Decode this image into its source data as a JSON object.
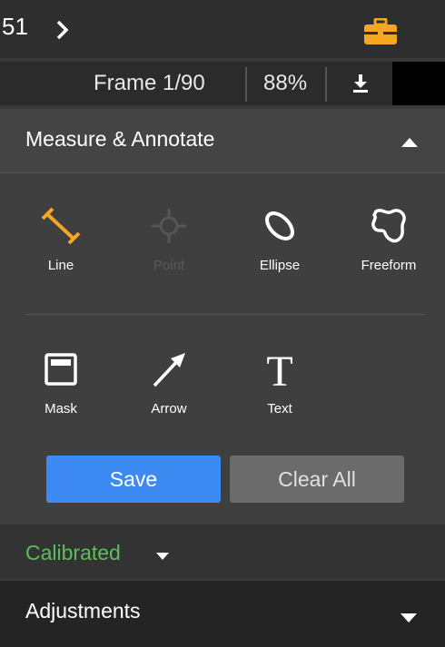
{
  "topbar": {
    "breadcrumb_fragment": "51",
    "chevron_icon": "chevron-right-icon",
    "toolbox_icon": "briefcase-icon",
    "toolbox_color": "#f5a623"
  },
  "framebar": {
    "frame_label": "Frame 1/90",
    "zoom_label": "88%",
    "download_icon": "download-icon"
  },
  "measure": {
    "title": "Measure & Annotate",
    "collapse_icon": "caret-up-icon",
    "tools_row1": [
      {
        "label": "Line",
        "icon": "line-icon",
        "active": true
      },
      {
        "label": "Point",
        "icon": "crosshair-icon",
        "disabled": true
      },
      {
        "label": "Ellipse",
        "icon": "ellipse-icon"
      },
      {
        "label": "Freeform",
        "icon": "freeform-icon"
      }
    ],
    "tools_row2": [
      {
        "label": "Mask",
        "icon": "mask-icon"
      },
      {
        "label": "Arrow",
        "icon": "arrow-icon"
      },
      {
        "label": "Text",
        "icon": "text-icon"
      }
    ],
    "save_label": "Save",
    "clear_label": "Clear All",
    "accent_color": "#f5a623",
    "save_color": "#3d8bf2"
  },
  "calibration": {
    "status": "Calibrated",
    "status_color": "#5bbf5b"
  },
  "adjustments": {
    "title": "Adjustments",
    "expand_icon": "caret-down-icon"
  }
}
